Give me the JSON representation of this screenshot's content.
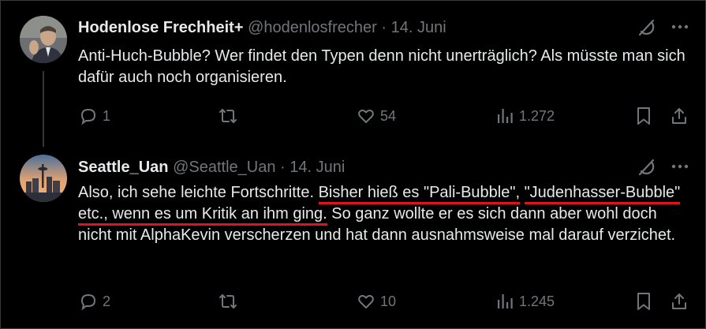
{
  "tweets": [
    {
      "name": "Hodenlose Frechheit+",
      "handle": "@hodenlosfrecher",
      "sep": "·",
      "date": "14. Juni",
      "text": "Anti-Huch-Bubble? Wer findet den Typen denn nicht unerträglich? Als müsste man sich dafür auch noch organisieren.",
      "replies": "1",
      "likes": "54",
      "views": "1.272"
    },
    {
      "name": "Seattle_Uan",
      "handle": "@Seattle_Uan",
      "sep": "·",
      "date": "14. Juni",
      "text_a": "Also, ich sehe leichte Fortschritte. ",
      "text_hl1": "Bisher hieß es \"Pali-Bubble\",",
      "text_hl2": "\"Judenhasser-Bubble\" etc., wenn es um Kritik an ihm ging.",
      "text_b": " So ganz wollte er es sich dann aber wohl doch nicht mit AlphaKevin verscherzen und hat dann ausnahmsweise mal darauf verzichet.",
      "replies": "2",
      "likes": "10",
      "views": "1.245"
    }
  ],
  "icons": {
    "grok": "grok-icon",
    "more": "more-options-icon",
    "reply": "reply-icon",
    "repost": "repost-icon",
    "like": "like-icon",
    "views": "views-icon",
    "bookmark": "bookmark-icon",
    "share": "share-icon"
  },
  "colors": {
    "background": "#000000",
    "text": "#e7e9ea",
    "secondary": "#71767b",
    "highlight_underline": "#e0131a"
  }
}
